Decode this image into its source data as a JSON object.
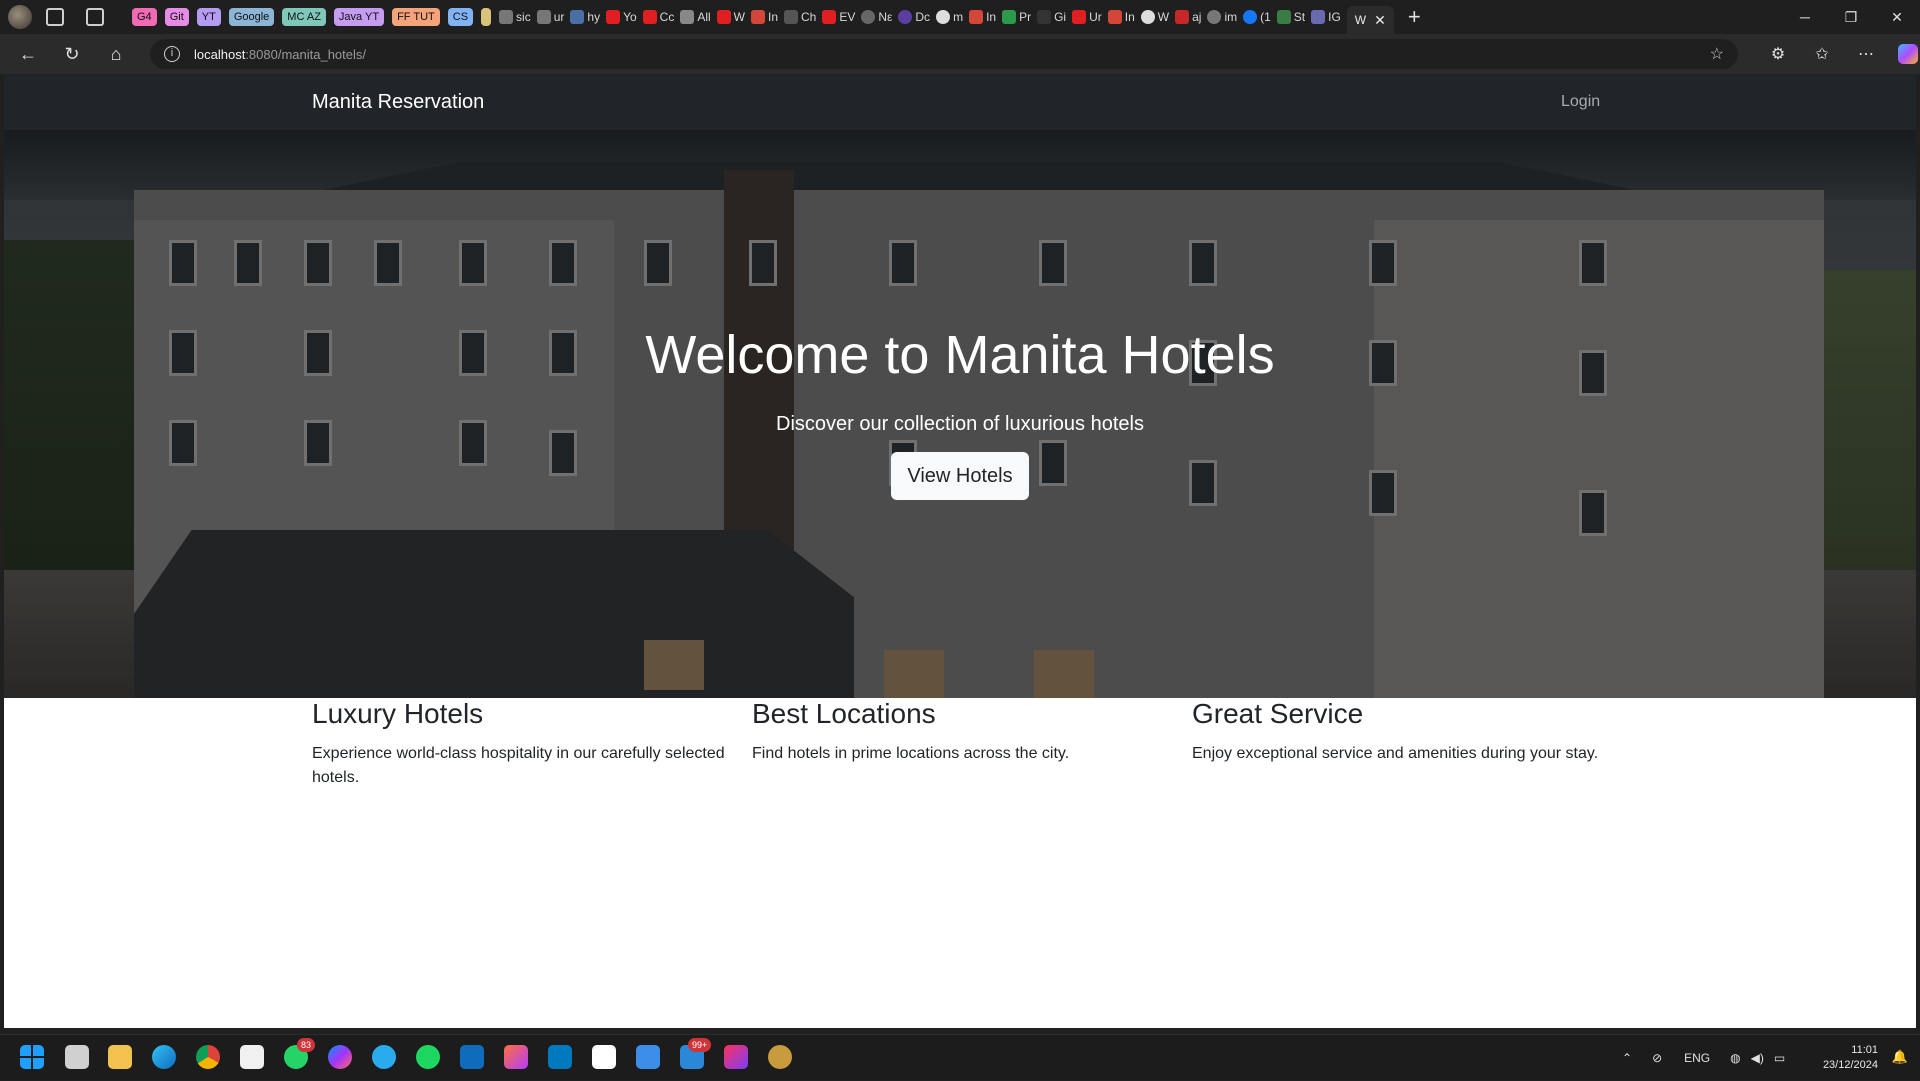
{
  "browser": {
    "tab_groups": [
      {
        "label": "G4",
        "color": "#f06bb4"
      },
      {
        "label": "Git",
        "color": "#e68ce6"
      },
      {
        "label": "YT",
        "color": "#b49cf2"
      },
      {
        "label": "Google",
        "color": "#8db5d6"
      },
      {
        "label": "MC AZ",
        "color": "#7fc7b8"
      },
      {
        "label": "Java YT",
        "color": "#c59cf0"
      },
      {
        "label": "FF TUT",
        "color": "#f5a37a"
      },
      {
        "label": "CS",
        "color": "#82b4f5"
      }
    ],
    "mini_tabs": [
      "sic",
      "ur",
      "hy",
      "Yo",
      "Cc",
      "All",
      "W",
      "In",
      "Ch",
      "EV",
      "Nε",
      "Dc",
      "m",
      "In",
      "Pr",
      "Gi",
      "Ur",
      "In",
      "W",
      "aj",
      "im",
      "(1",
      "St",
      "IG"
    ],
    "active_tab": "W",
    "address": {
      "host": "localhost",
      "path": ":8080/manita_hotels/"
    }
  },
  "page": {
    "brand": "Manita Reservation",
    "login": "Login",
    "hero": {
      "title": "Welcome to Manita Hotels",
      "subtitle": "Discover our collection of luxurious hotels",
      "button": "View Hotels"
    },
    "features": [
      {
        "title": "Luxury Hotels",
        "text": "Experience world-class hospitality in our carefully selected hotels."
      },
      {
        "title": "Best Locations",
        "text": "Find hotels in prime locations across the city."
      },
      {
        "title": "Great Service",
        "text": "Enjoy exceptional service and amenities during your stay."
      }
    ]
  },
  "taskbar": {
    "whatsapp_badge": "83",
    "outlook_badge": "99+",
    "language": "ENG",
    "time": "11:01",
    "date": "23/12/2024"
  }
}
